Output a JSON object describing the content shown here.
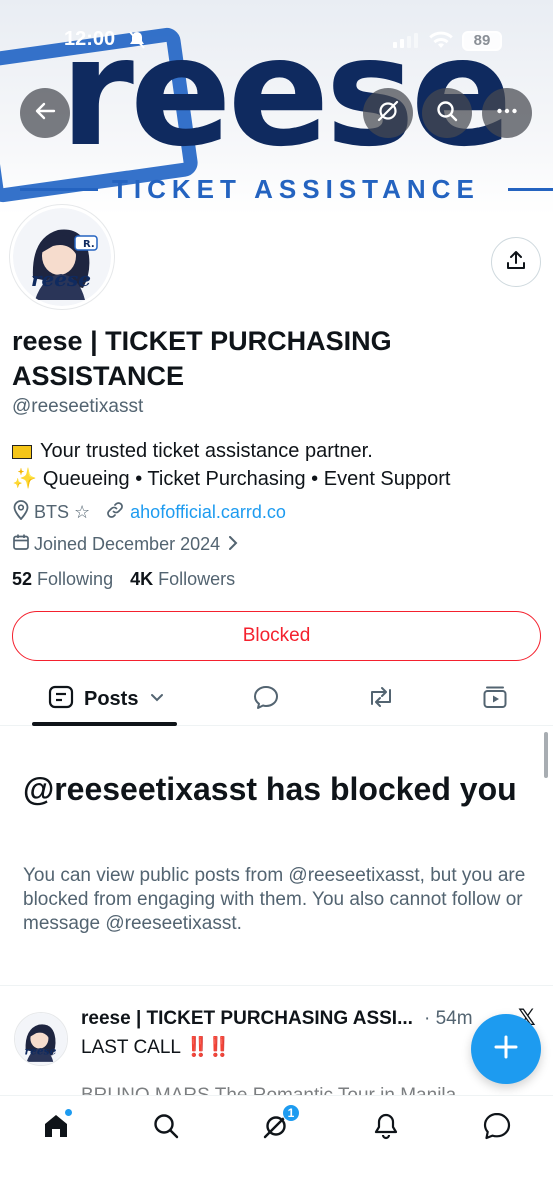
{
  "status_bar": {
    "time": "12:00",
    "battery": "89"
  },
  "banner": {
    "word": "reese",
    "subtitle": "TICKET ASSISTANCE"
  },
  "profile": {
    "name": "reese | TICKET PURCHASING ASSISTANCE",
    "handle": "@reeseetixasst",
    "bio_line1": "Your trusted ticket assistance partner.",
    "bio_line2": "Queueing • Ticket Purchasing • Event Support",
    "location": "BTS ☆",
    "website": "ahofofficial.carrd.co",
    "joined": "Joined December 2024",
    "following_count": "52",
    "following_label": "Following",
    "followers_count": "4K",
    "followers_label": "Followers",
    "blocked_button": "Blocked"
  },
  "tabs": {
    "posts_label": "Posts"
  },
  "blocked_notice": {
    "title": "@reeseetixasst has blocked you",
    "description": "You can view public posts from @reeseetixasst, but you are blocked from engaging with them. You also cannot follow or message @reeseetixasst."
  },
  "post": {
    "author": "reese | TICKET PURCHASING ASSI...",
    "time": "· 54m",
    "text": "LAST CALL",
    "emphasis": "‼️‼️",
    "text_line2": "BRUNO MARS The Romantic Tour in Manila"
  },
  "bottom_nav": {
    "notifications_badge": "1"
  },
  "colors": {
    "accent": "#1d9bf0",
    "danger": "#f4212e",
    "banner_navy": "#0f2a5f",
    "banner_blue": "#2463c0"
  }
}
